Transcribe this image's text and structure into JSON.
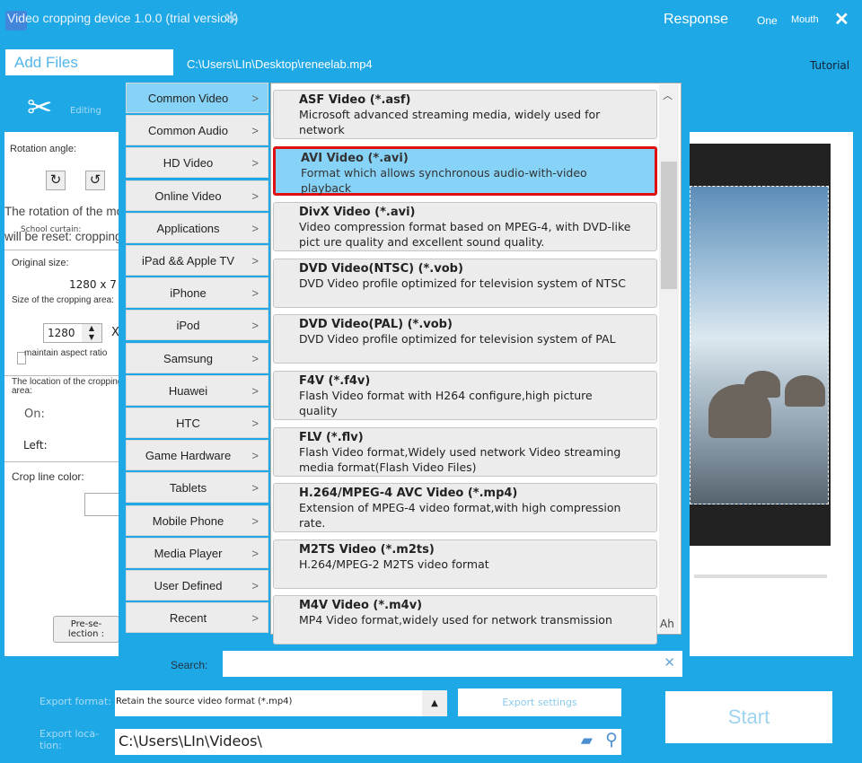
{
  "app": {
    "title": "Video cropping device 1.0.0 (trial version)",
    "response": "Response",
    "one": "One",
    "mouth": "Mouth",
    "close": "✕"
  },
  "toolbar": {
    "add_files": "Add Files",
    "file_path": "C:\\Users\\LIn\\Desktop\\reneelab.mp4",
    "tutorial": "Tutorial",
    "editing": "Editing"
  },
  "left": {
    "rotation_angle": "Rotation angle:",
    "rotation_note_1": "The rotation of the movie",
    "rotation_note_2": "will be reset: cropping, filte",
    "school_curtain": "School curtain:",
    "original_size": "Original size:",
    "original_value": "1280 x 7",
    "crop_size": "Size of the cropping area:",
    "width_value": "1280",
    "x": "X",
    "maintain": "maintain aspect ratio",
    "location": "The location of the cropping area:",
    "on": "On:",
    "left": "Left:",
    "crop_line_color": "Crop line color:",
    "preselection": "Pre-se-\nlection :"
  },
  "categories": [
    "Common Video",
    "Common Audio",
    "HD Video",
    "Online Video",
    "Applications",
    "iPad && Apple TV",
    "iPhone",
    "iPod",
    "Samsung",
    "Huawei",
    "HTC",
    "Game Hardware",
    "Tablets",
    "Mobile Phone",
    "Media Player",
    "User Defined",
    "Recent"
  ],
  "formats": [
    {
      "name": "ASF Video (*.asf)",
      "desc": "Microsoft advanced streaming media, widely used for network"
    },
    {
      "name": "AVI Video (*.avi)",
      "desc": "Format which allows synchronous audio-with-video playback"
    },
    {
      "name": "DivX Video (*.avi)",
      "desc": "Video compression format based on MPEG-4, with DVD-like pict ure quality and excellent sound quality."
    },
    {
      "name": "DVD Video(NTSC) (*.vob)",
      "desc": "DVD Video profile optimized for television system of NTSC"
    },
    {
      "name": "DVD Video(PAL) (*.vob)",
      "desc": "DVD Video profile optimized for television system of PAL"
    },
    {
      "name": "F4V (*.f4v)",
      "desc": "Flash Video format with H264 configure,high picture quality"
    },
    {
      "name": "FLV (*.flv)",
      "desc": "Flash Video format,Widely used network Video streaming media format(Flash Video Files)"
    },
    {
      "name": "H.264/MPEG-4 AVC Video (*.mp4)",
      "desc": "Extension of MPEG-4 video format,with high compression rate."
    },
    {
      "name": "M2TS Video (*.m2ts)",
      "desc": "H.264/MPEG-2 M2TS video format"
    },
    {
      "name": "M4V Video (*.m4v)",
      "desc": "MP4 Video format,widely used for network transmission"
    }
  ],
  "selected_category": "Common Video",
  "selected_format": "AVI Video (*.avi)",
  "scroll_hint": "Ah",
  "search": {
    "label": "Search:",
    "value": "",
    "clear": "✕"
  },
  "export": {
    "format_label": "Export format:",
    "format_value": "Retain the source video format (*.mp4)",
    "settings": "Export settings",
    "location_label": "Export loca-\ntion:",
    "location_value": "C:\\Users\\LIn\\Videos\\",
    "start": "Start"
  },
  "colors": {
    "background": "#1fa8e6",
    "selected": "#87d3f7",
    "highlight_border": "#e01010"
  }
}
